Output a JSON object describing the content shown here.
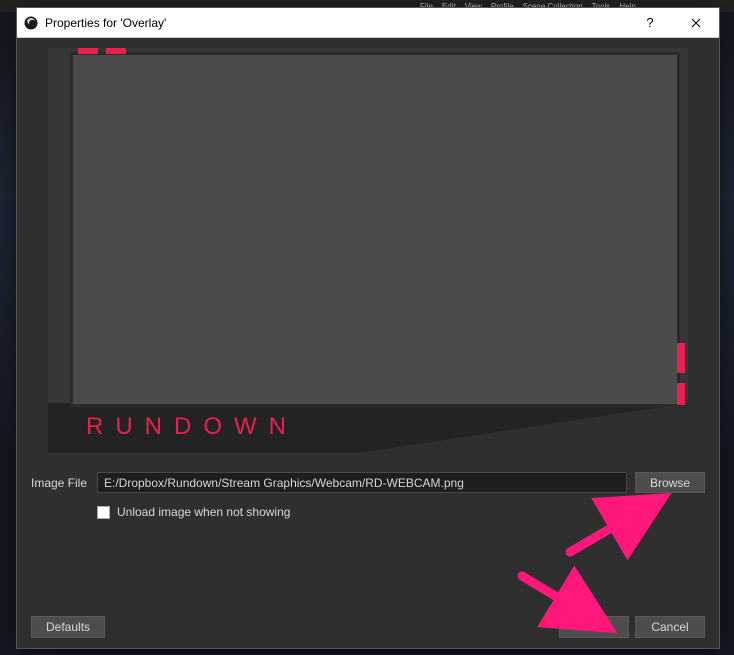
{
  "bg_menu": [
    "File",
    "Edit",
    "View",
    "Profile",
    "Scene Collection",
    "Tools",
    "Help"
  ],
  "titlebar": {
    "title": "Properties for 'Overlay'"
  },
  "preview": {
    "brand_text": "RUNDOWN",
    "accent_color": "#e9204f"
  },
  "form": {
    "image_file_label": "Image File",
    "image_file_value": "E:/Dropbox/Rundown/Stream Graphics/Webcam/RD-WEBCAM.png",
    "browse_label": "Browse",
    "unload_label": "Unload image when not showing",
    "unload_checked": false
  },
  "footer": {
    "defaults_label": "Defaults",
    "ok_label": "OK",
    "cancel_label": "Cancel"
  }
}
